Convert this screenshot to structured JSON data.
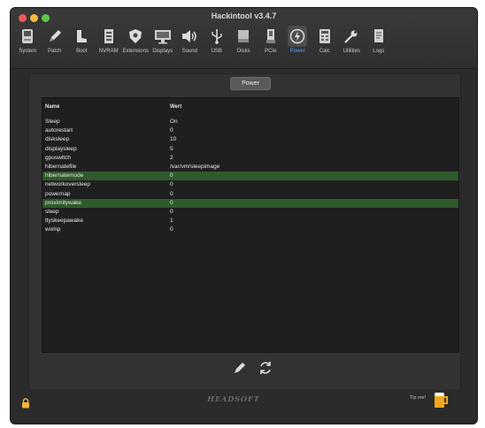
{
  "window": {
    "title": "Hackintool v3.4.7",
    "accent_color": "#4da3ff",
    "selection_color": "#2f5a2b"
  },
  "toolbar": {
    "items": [
      {
        "label": "System",
        "icon": "system-icon"
      },
      {
        "label": "Patch",
        "icon": "patch-pencil-icon"
      },
      {
        "label": "Boot",
        "icon": "boot-icon"
      },
      {
        "label": "NVRAM",
        "icon": "nvram-chip-icon"
      },
      {
        "label": "Extensions",
        "icon": "extensions-shield-icon"
      },
      {
        "label": "Displays",
        "icon": "display-monitor-icon"
      },
      {
        "label": "Sound",
        "icon": "speaker-icon"
      },
      {
        "label": "USB",
        "icon": "usb-icon"
      },
      {
        "label": "Disks",
        "icon": "disk-icon"
      },
      {
        "label": "PCIe",
        "icon": "pcie-card-icon"
      },
      {
        "label": "Power",
        "icon": "power-bolt-icon",
        "active": true
      },
      {
        "label": "Calc",
        "icon": "calculator-icon"
      },
      {
        "label": "Utilities",
        "icon": "wrench-icon"
      },
      {
        "label": "Logs",
        "icon": "logs-icon"
      }
    ]
  },
  "section": {
    "title": "Power"
  },
  "table": {
    "col_name": "Name",
    "col_value": "Wert",
    "rows": [
      {
        "name": "Sleep",
        "value": "On"
      },
      {
        "name": "autorestart",
        "value": "0"
      },
      {
        "name": "disksleep",
        "value": "10"
      },
      {
        "name": "displaysleep",
        "value": "5"
      },
      {
        "name": "gpuswitch",
        "value": "2"
      },
      {
        "name": "hibernatefile",
        "value": "/var/vm/sleepimage"
      },
      {
        "name": "hibernatemode",
        "value": "0",
        "selected": true
      },
      {
        "name": "networkoversleep",
        "value": "0"
      },
      {
        "name": "powernap",
        "value": "0"
      },
      {
        "name": "proximitywake",
        "value": "0",
        "selected": true
      },
      {
        "name": "sleep",
        "value": "0"
      },
      {
        "name": "ttyskeepawake",
        "value": "1"
      },
      {
        "name": "womp",
        "value": "0"
      }
    ]
  },
  "footer": {
    "logo": "HEADSOFT",
    "tip_me": "Tip me!"
  }
}
